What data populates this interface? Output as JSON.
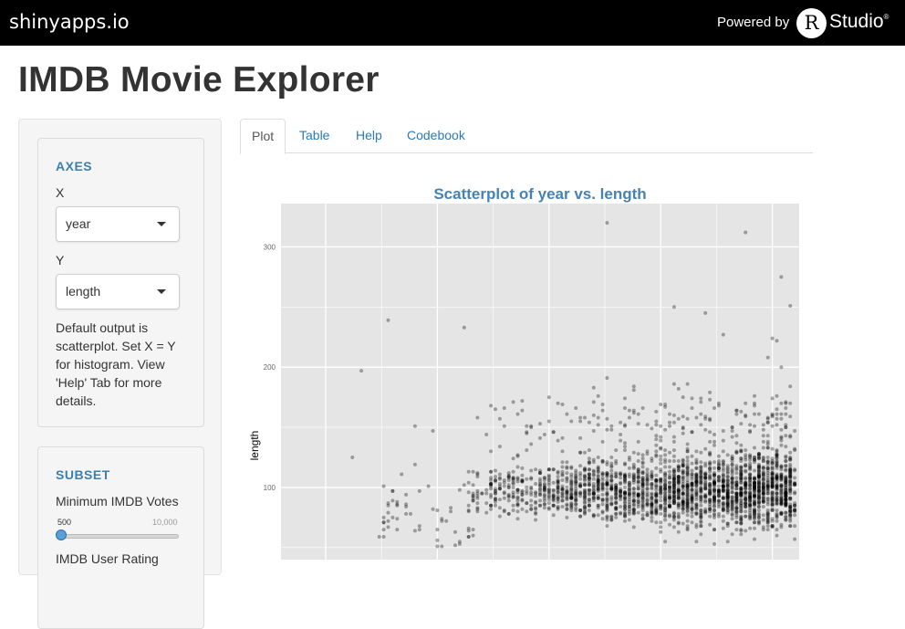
{
  "topbar": {
    "brand": "shinyapps.io",
    "powered_by": "Powered by",
    "r_letter": "R",
    "studio": "Studio",
    "reg": "®"
  },
  "page": {
    "title": "IMDB Movie Explorer"
  },
  "sidebar": {
    "axes": {
      "title": "AXES",
      "x_label": "X",
      "x_value": "year",
      "y_label": "Y",
      "y_value": "length",
      "help": "Default output is scatterplot. Set X = Y for histogram. View 'Help' Tab for more details."
    },
    "subset": {
      "title": "SUBSET",
      "min_votes_label": "Minimum IMDB Votes",
      "min_votes_value": "500",
      "min_votes_max": "10,000",
      "min_votes_fraction": 0.0,
      "rating_label": "IMDB User Rating"
    }
  },
  "tabs": [
    {
      "label": "Plot",
      "active": true
    },
    {
      "label": "Table",
      "active": false
    },
    {
      "label": "Help",
      "active": false
    },
    {
      "label": "Codebook",
      "active": false
    }
  ],
  "colors": {
    "accent": "#4682b4",
    "link": "#2a7ab8",
    "panel_bg": "#e5e5e5",
    "grid": "#ffffff",
    "point": "#000000"
  },
  "chart_data": {
    "type": "scatter",
    "title": "Scatterplot of year vs. length",
    "xlabel": "",
    "ylabel": "length",
    "yticks": [
      100,
      200,
      300
    ],
    "ylim": [
      40,
      336
    ],
    "xlim": [
      1890,
      2006
    ],
    "grid": true,
    "highlight_points": [
      {
        "x": 1906,
        "y": 125
      },
      {
        "x": 1908,
        "y": 197
      },
      {
        "x": 1914,
        "y": 239
      },
      {
        "x": 1920,
        "y": 151
      },
      {
        "x": 1924,
        "y": 147
      },
      {
        "x": 1931,
        "y": 233
      },
      {
        "x": 1963,
        "y": 320
      },
      {
        "x": 1978,
        "y": 250
      },
      {
        "x": 1985,
        "y": 245
      },
      {
        "x": 1994,
        "y": 312
      },
      {
        "x": 2002,
        "y": 275
      },
      {
        "x": 2004,
        "y": 251
      },
      {
        "x": 2000,
        "y": 224
      },
      {
        "x": 2001,
        "y": 222
      },
      {
        "x": 1989,
        "y": 227
      }
    ]
  }
}
